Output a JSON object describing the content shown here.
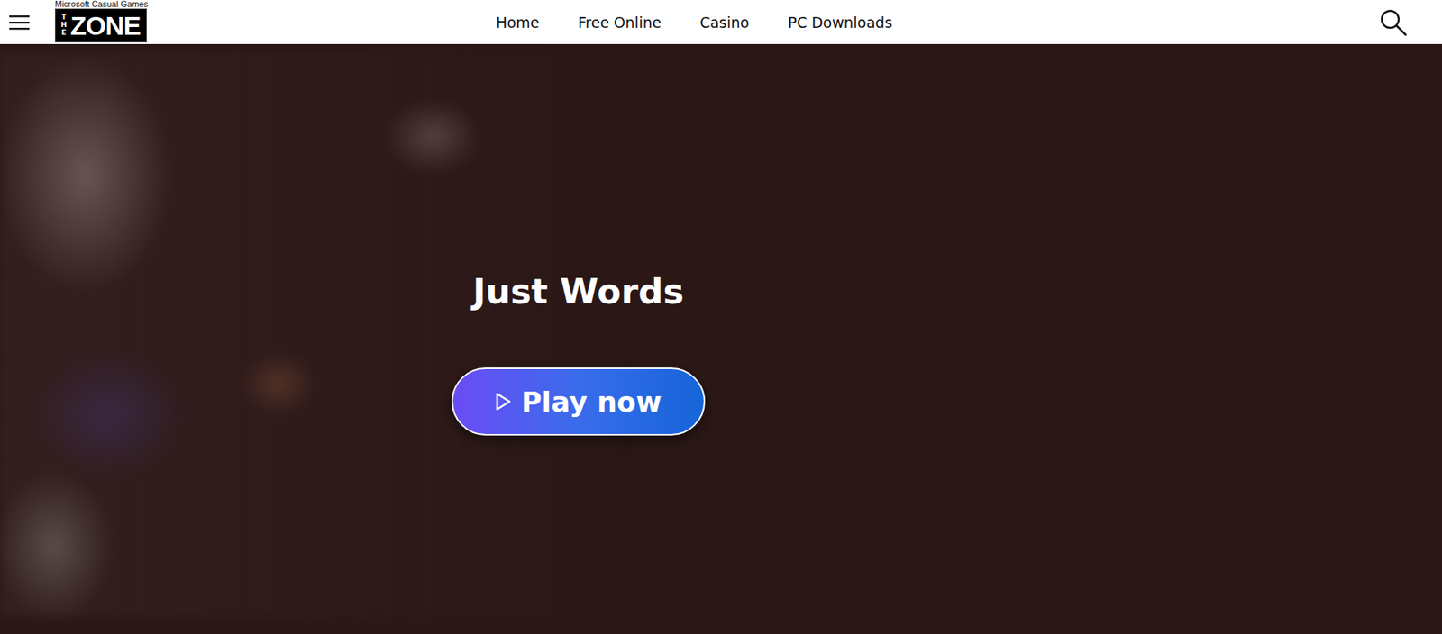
{
  "header": {
    "logo": {
      "tagline": "Microsoft Casual Games",
      "the": "THE",
      "name": "ZONE"
    },
    "nav": [
      {
        "label": "Home",
        "selected": false
      },
      {
        "label": "Free Online",
        "selected": false
      },
      {
        "label": "Casino",
        "selected": false
      },
      {
        "label": "PC Downloads",
        "selected": false
      }
    ]
  },
  "hero": {
    "title": "Just Words",
    "button": "Play now"
  }
}
